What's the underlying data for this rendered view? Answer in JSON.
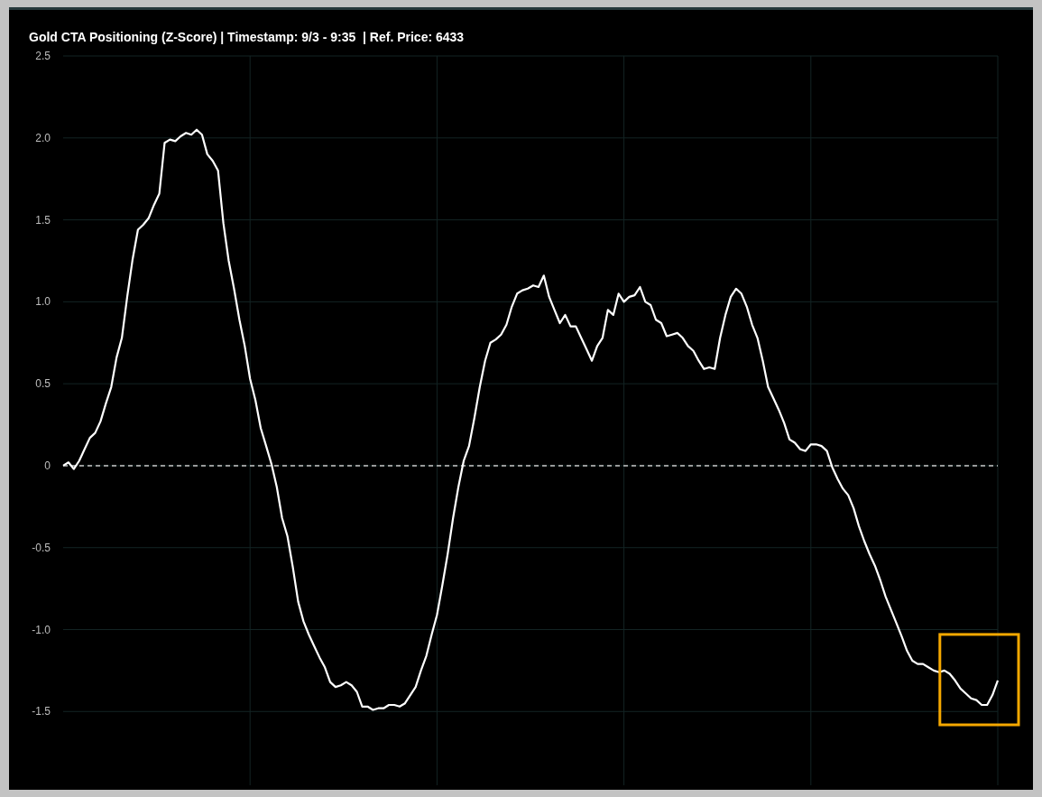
{
  "chart": {
    "chart_data": {
      "type": "line",
      "title": "Gold CTA Positioning (Z-Score) | Timestamp: 9/3 - 9:35  | Ref. Price: 6433",
      "grid": true,
      "ylim": [
        -1.95,
        2.5
      ],
      "yticks": [
        {
          "value": 2.5,
          "label": "2.5"
        },
        {
          "value": 2,
          "label": "2.0"
        },
        {
          "value": 1.5,
          "label": "1.5"
        },
        {
          "value": 1,
          "label": "1.0"
        },
        {
          "value": 0.5,
          "label": "0.5"
        },
        {
          "value": 0,
          "label": "0"
        },
        {
          "value": -0.5,
          "label": "-0.5"
        },
        {
          "value": -1,
          "label": "-1.0"
        },
        {
          "value": -1.5,
          "label": "-1.5"
        }
      ],
      "ref_lines": [
        {
          "axis": "y",
          "value": 0
        }
      ],
      "series": [
        {
          "color": "#ffffff",
          "values": [
            0,
            0.02,
            -0.02,
            0.03,
            0.1,
            0.17,
            0.2,
            0.27,
            0.38,
            0.48,
            0.66,
            0.78,
            1.03,
            1.26,
            1.44,
            1.47,
            1.51,
            1.59,
            1.66,
            1.97,
            1.99,
            1.98,
            2.01,
            2.03,
            2.02,
            2.05,
            2.02,
            1.9,
            1.86,
            1.8,
            1.48,
            1.25,
            1.08,
            0.89,
            0.73,
            0.53,
            0.4,
            0.23,
            0.12,
            0.01,
            -0.13,
            -0.32,
            -0.43,
            -0.62,
            -0.83,
            -0.95,
            -1.03,
            -1.1,
            -1.17,
            -1.23,
            -1.32,
            -1.35,
            -1.34,
            -1.32,
            -1.34,
            -1.38,
            -1.47,
            -1.47,
            -1.49,
            -1.48,
            -1.48,
            -1.46,
            -1.46,
            -1.47,
            -1.45,
            -1.4,
            -1.35,
            -1.25,
            -1.16,
            -1.03,
            -0.91,
            -0.73,
            -0.54,
            -0.32,
            -0.13,
            0.03,
            0.12,
            0.29,
            0.48,
            0.64,
            0.75,
            0.77,
            0.8,
            0.86,
            0.97,
            1.05,
            1.07,
            1.08,
            1.1,
            1.09,
            1.16,
            1.03,
            0.95,
            0.87,
            0.92,
            0.85,
            0.85,
            0.78,
            0.71,
            0.64,
            0.73,
            0.78,
            0.95,
            0.92,
            1.05,
            1,
            1.03,
            1.04,
            1.09,
            1,
            0.98,
            0.89,
            0.87,
            0.79,
            0.8,
            0.81,
            0.78,
            0.73,
            0.7,
            0.64,
            0.59,
            0.6,
            0.59,
            0.78,
            0.92,
            1.03,
            1.08,
            1.05,
            0.97,
            0.86,
            0.78,
            0.64,
            0.48,
            0.41,
            0.34,
            0.26,
            0.16,
            0.14,
            0.1,
            0.09,
            0.13,
            0.13,
            0.12,
            0.09,
            -0.01,
            -0.08,
            -0.14,
            -0.18,
            -0.26,
            -0.37,
            -0.46,
            -0.54,
            -0.61,
            -0.7,
            -0.8,
            -0.88,
            -0.96,
            -1.04,
            -1.13,
            -1.19,
            -1.21,
            -1.21,
            -1.23,
            -1.25,
            -1.26,
            -1.25,
            -1.27,
            -1.31,
            -1.36,
            -1.39,
            -1.42,
            -1.43,
            -1.46,
            -1.46,
            -1.4,
            -1.31
          ]
        }
      ]
    }
  }
}
